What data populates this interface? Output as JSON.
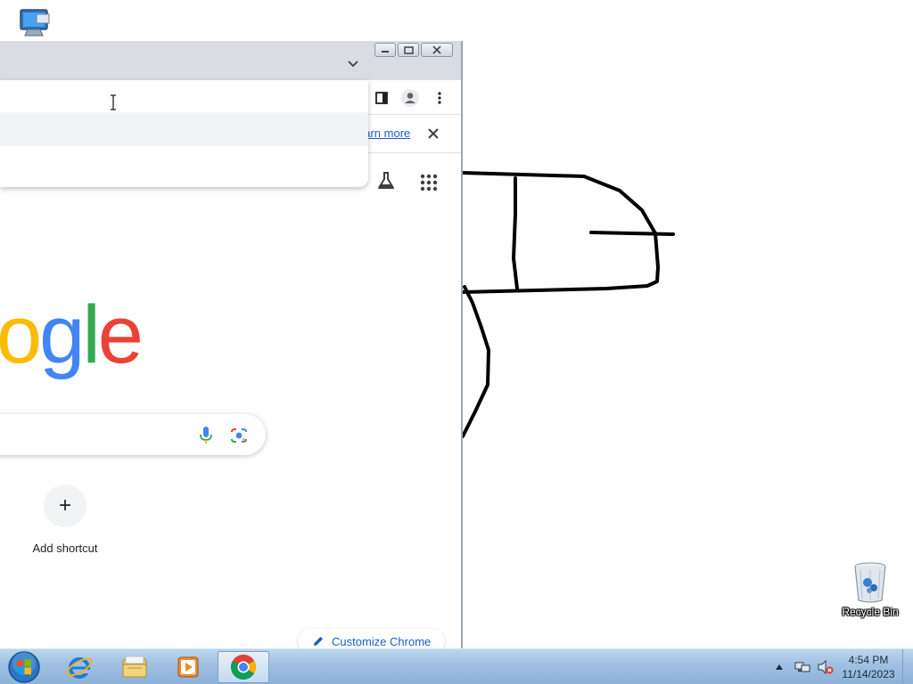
{
  "desktop": {
    "computer_icon": "computer-icon",
    "recycle_bin": {
      "label": "Recycle Bin",
      "icon": "recycle-bin-icon"
    }
  },
  "chrome": {
    "caption_buttons": [
      "minimize",
      "maximize",
      "close"
    ],
    "infobar": {
      "link": "earn more"
    },
    "ntp": {
      "logo_text": {
        "o": "o",
        "g": "g",
        "l": "l",
        "e": "e"
      },
      "add_shortcut": {
        "symbol": "+",
        "label": "Add shortcut"
      },
      "customize": {
        "label": "Customize Chrome"
      }
    },
    "colors": {
      "blue": "#4285f4",
      "red": "#ea4335",
      "yellow": "#fbbc05",
      "green": "#34a853",
      "link": "#1a5cc8"
    }
  },
  "taskbar": {
    "items": [
      "start-orb",
      "internet-explorer",
      "windows-explorer",
      "media-player",
      "google-chrome"
    ],
    "active": "google-chrome",
    "clock": {
      "time": "4:54 PM",
      "date": "11/14/2023"
    }
  }
}
